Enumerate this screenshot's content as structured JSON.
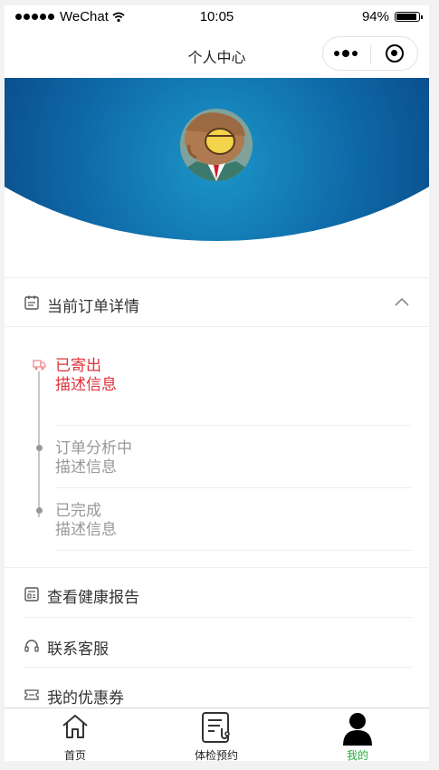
{
  "status_bar": {
    "carrier": "WeChat",
    "time": "10:05",
    "battery": "94%",
    "battery_level": 0.94
  },
  "nav": {
    "title": "个人中心"
  },
  "order_section": {
    "title": "当前订单详情",
    "steps": [
      {
        "title": "已寄出",
        "desc": "描述信息",
        "state": "active"
      },
      {
        "title": "订单分析中",
        "desc": "描述信息",
        "state": "pending"
      },
      {
        "title": "已完成",
        "desc": "描述信息",
        "state": "pending"
      }
    ]
  },
  "menu": {
    "report": "查看健康报告",
    "service": "联系客服",
    "coupon": "我的优惠券"
  },
  "tabbar": {
    "tabs": [
      {
        "label": "首页",
        "icon": "home-icon"
      },
      {
        "label": "体检预约",
        "icon": "checkup-clipboard-icon"
      },
      {
        "label": "我的",
        "icon": "person-icon",
        "active": true
      }
    ]
  },
  "colors": {
    "accent": "#e0313a",
    "active_tab": "#22ac38",
    "hero_dark": "#032c66",
    "hero_light": "#1b96c8"
  }
}
